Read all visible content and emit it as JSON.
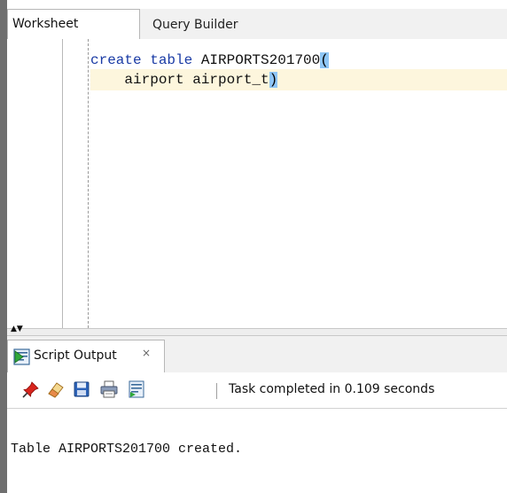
{
  "editor_tabs": [
    {
      "label": "Worksheet",
      "active": true
    },
    {
      "label": "Query Builder",
      "active": false
    }
  ],
  "editor": {
    "line1": {
      "kw": "create table",
      "name": " AIRPORTS201700",
      "brace": "("
    },
    "line2": {
      "text": "    airport airport_t",
      "brace": ")"
    }
  },
  "output_panel": {
    "tab_label": "Script Output",
    "close_glyph": "×",
    "status": "Task completed in 0.109 seconds",
    "result_text": "Table AIRPORTS201700 created."
  },
  "toolbar": {
    "buttons": [
      "pin-icon",
      "eraser-icon",
      "save-icon",
      "print-icon",
      "script-icon"
    ]
  },
  "colors": {
    "keyword": "#1a3ba5",
    "brace_highlight": "#8fc6f5",
    "current_line": "#fdf6dd"
  }
}
